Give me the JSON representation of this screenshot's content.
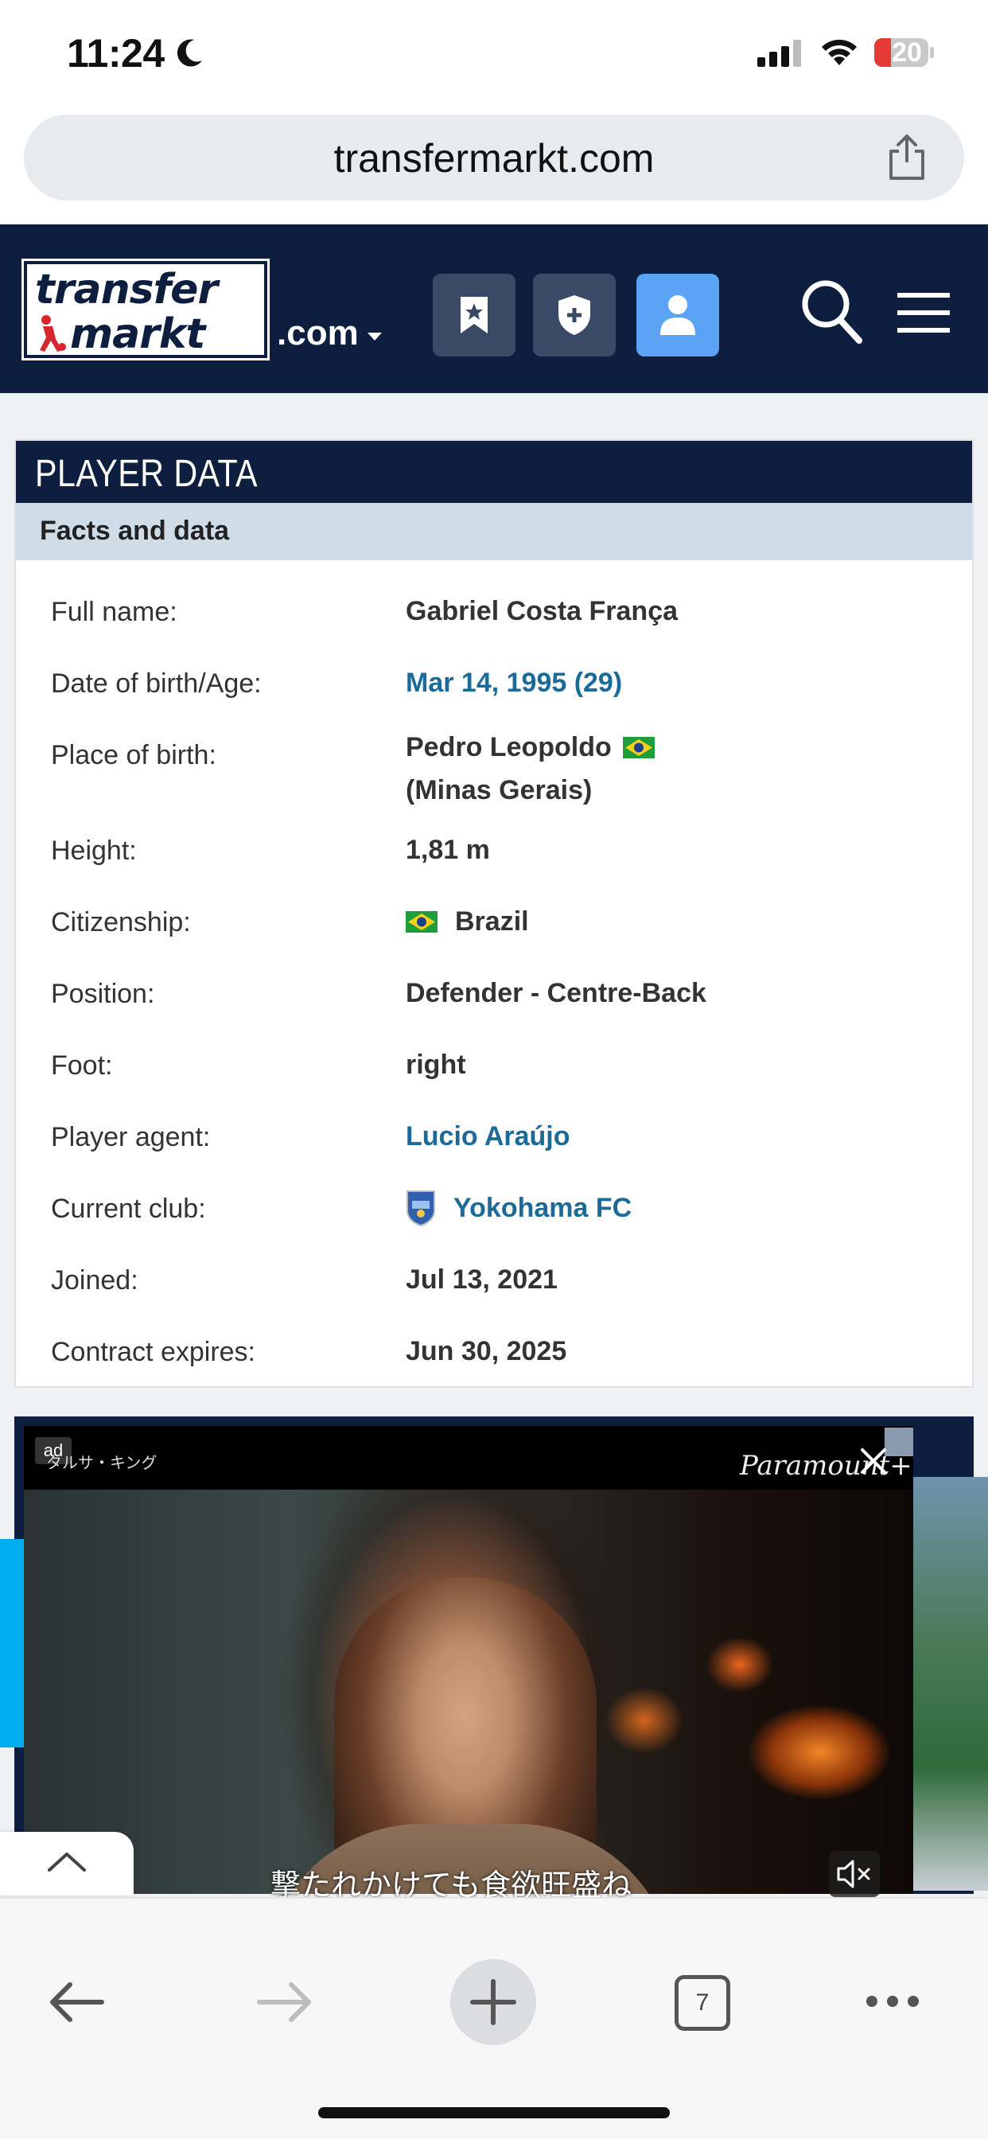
{
  "status_bar": {
    "time": "11:24",
    "battery": "20"
  },
  "browser": {
    "url": "transfermarkt.com"
  },
  "site_header": {
    "logo_line1": "transfer",
    "logo_line2": "markt",
    "domain_suffix": ".com"
  },
  "player_data": {
    "title": "PLAYER DATA",
    "subtitle": "Facts and data",
    "rows": [
      {
        "label": "Full name:",
        "value": "Gabriel Costa França"
      },
      {
        "label": "Date of birth/Age:",
        "value": "Mar 14, 1995 (29)"
      },
      {
        "label": "Place of birth:",
        "value": "Pedro Leopoldo",
        "value2": "(Minas Gerais)"
      },
      {
        "label": "Height:",
        "value": "1,81 m"
      },
      {
        "label": "Citizenship:",
        "value": "Brazil"
      },
      {
        "label": "Position:",
        "value": "Defender - Centre-Back"
      },
      {
        "label": "Foot:",
        "value": "right"
      },
      {
        "label": "Player agent:",
        "value": "Lucio Araújo"
      },
      {
        "label": "Current club:",
        "value": "Yokohama FC"
      },
      {
        "label": "Joined:",
        "value": "Jul 13, 2021"
      },
      {
        "label": "Contract expires:",
        "value": "Jun 30, 2025"
      }
    ]
  },
  "ad": {
    "label": "ad",
    "top_text": "タルサ・キング",
    "brand": "Paramount+",
    "subtitle": "撃たれかけても食欲旺盛ね"
  },
  "toolbar": {
    "tab_count": "7"
  },
  "colors": {
    "navy": "#0d1e3e",
    "link": "#1b6a9a",
    "subheader": "#cfdde9",
    "accent_blue": "#5ba4f5"
  }
}
